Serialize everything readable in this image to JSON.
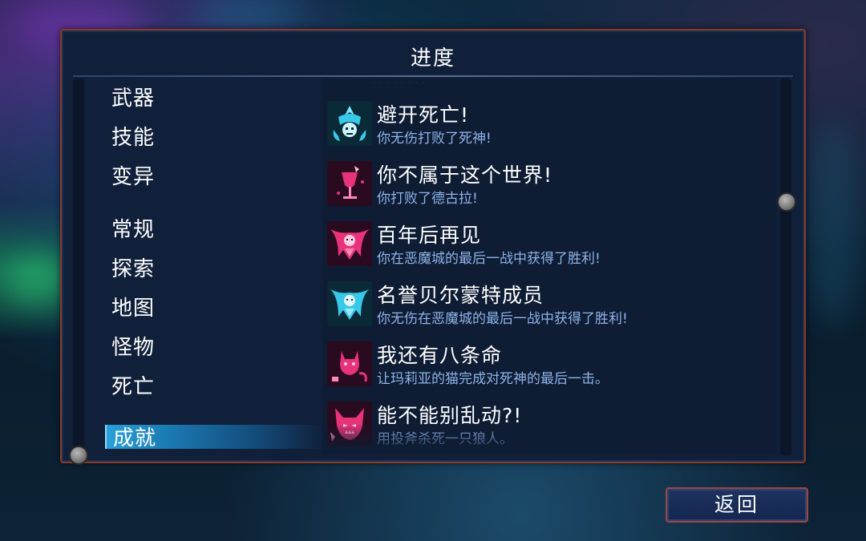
{
  "panel": {
    "title": "进度"
  },
  "categories": [
    {
      "label": "武器"
    },
    {
      "label": "技能"
    },
    {
      "label": "变异"
    },
    {
      "label": "常规"
    },
    {
      "label": "探索"
    },
    {
      "label": "地图"
    },
    {
      "label": "怪物"
    },
    {
      "label": "死亡"
    }
  ],
  "selected_category": {
    "label": "成就"
  },
  "achievements": [
    {
      "title": "避开死亡!",
      "description": "你无伤打败了死神!",
      "icon": "reaper-skull-icon",
      "color": "#38c8e8"
    },
    {
      "title": "你不属于这个世界!",
      "description": "你打败了德古拉!",
      "icon": "wine-glass-icon",
      "color": "#e8337a"
    },
    {
      "title": "百年后再见",
      "description": "你在恶魔城的最后一战中获得了胜利!",
      "icon": "dracula-icon",
      "color": "#e8337a"
    },
    {
      "title": "名誉贝尔蒙特成员",
      "description": "你无伤在恶魔城的最后一战中获得了胜利!",
      "icon": "dracula-cyan-icon",
      "color": "#38c8e8"
    },
    {
      "title": "我还有八条命",
      "description": "让玛莉亚的猫完成对死神的最后一击。",
      "icon": "cat-icon",
      "color": "#e8337a"
    },
    {
      "title": "能不能别乱动?!",
      "description": "用投斧杀死一只狼人。",
      "icon": "werewolf-icon",
      "color": "#e8337a"
    }
  ],
  "back_button": {
    "label": "返回"
  },
  "colors": {
    "accent_cyan": "#38c8e8",
    "accent_pink": "#e8337a",
    "frame": "#8a3a2a",
    "desc_text": "#8fb4e8"
  }
}
